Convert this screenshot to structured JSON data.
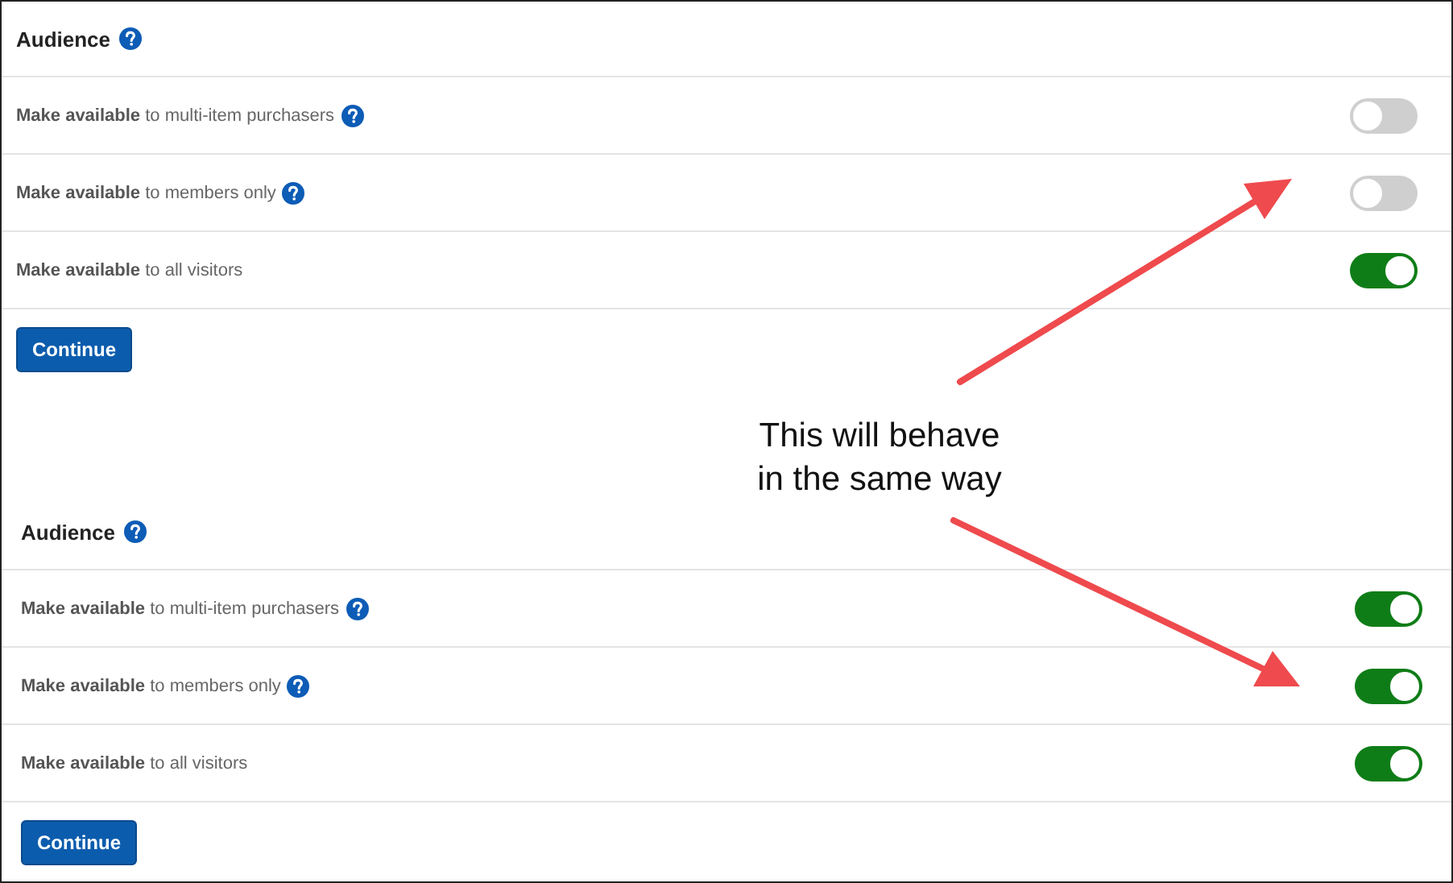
{
  "panels": [
    {
      "heading": {
        "text": "Audience",
        "help": true
      },
      "options": [
        {
          "label": "**Make available** to multi-item purchasers",
          "help": true,
          "on": false
        },
        {
          "label": "**Make available** to members only",
          "help": true,
          "on": false
        },
        {
          "label": "**Make available** to all visitors",
          "help": false,
          "on": true
        }
      ],
      "button": "Continue"
    },
    {
      "heading": {
        "text": "Audience",
        "help": true
      },
      "options": [
        {
          "label": "**Make available** to multi-item purchasers",
          "help": true,
          "on": true
        },
        {
          "label": "**Make available** to members only",
          "help": true,
          "on": true
        },
        {
          "label": "**Make available** to all visitors",
          "help": false,
          "on": true
        }
      ],
      "button": "Continue"
    }
  ],
  "annotation": {
    "text": "This will behave\nin the same way"
  }
}
